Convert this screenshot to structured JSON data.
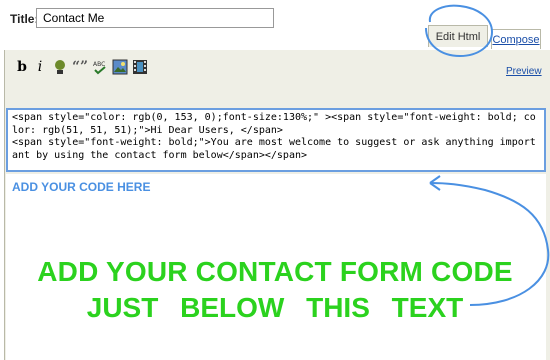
{
  "post": {
    "title_label": "Title:",
    "title_value": "Contact Me"
  },
  "tabs": {
    "edit_html": "Edit Html",
    "compose": "Compose"
  },
  "toolbar": {
    "bold": "b",
    "italic": "i",
    "quote": "“”",
    "preview": "Preview"
  },
  "code": {
    "text": "<span style=\"color: rgb(0, 153, 0);font-size:130%;\" ><span style=\"font-weight: bold; color: rgb(51, 51, 51);\">Hi Dear Users, </span>\n<span style=\"font-weight: bold;\">You are most welcome to suggest or ask anything important by using the contact form below</span></span>"
  },
  "annotations": {
    "add_code": "ADD YOUR CODE HERE",
    "line1": "ADD YOUR CONTACT FORM CODE",
    "line2": "JUST BELOW THIS TEXT"
  },
  "colors": {
    "highlight_blue": "#4a90e2",
    "green": "#2bd21e"
  }
}
